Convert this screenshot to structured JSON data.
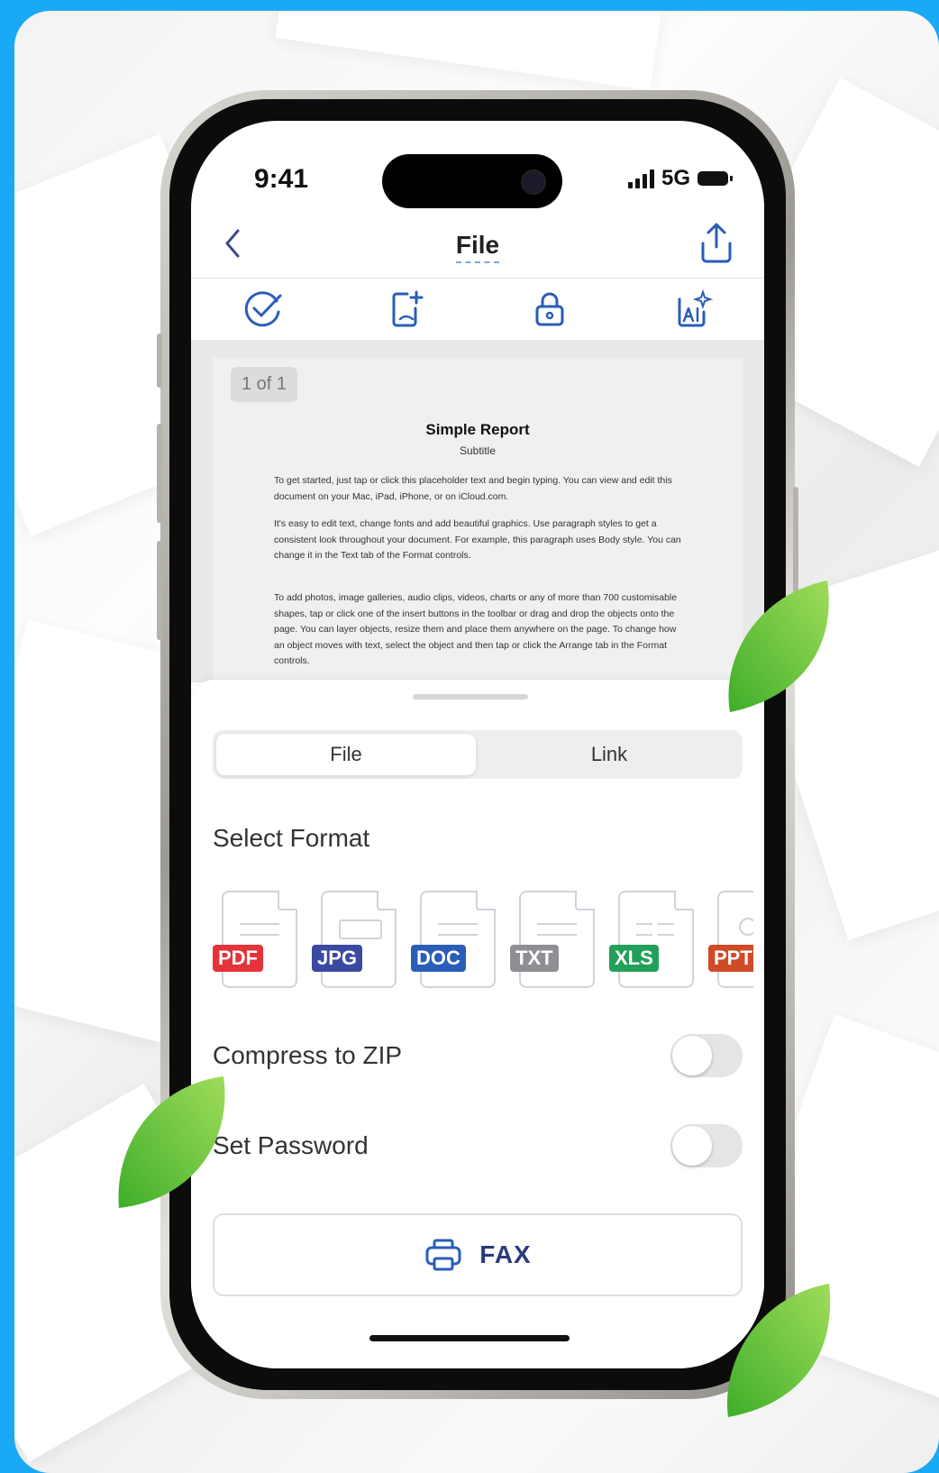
{
  "status": {
    "time": "9:41",
    "network": "5G"
  },
  "nav": {
    "title": "File"
  },
  "document": {
    "page_indicator": "1 of 1",
    "title": "Simple Report",
    "subtitle": "Subtitle",
    "paragraphs": [
      "To get started, just tap or click this placeholder text and begin typing. You can view and edit this document on your Mac, iPad, iPhone, or on iCloud.com.",
      "It's easy to edit text, change fonts and add beautiful graphics. Use paragraph styles to get a consistent look throughout your document. For example, this paragraph uses Body style. You can change it in the Text tab of the Format controls.",
      "To add photos, image galleries, audio clips, videos, charts or any of more than 700 customisable shapes, tap or click one of the insert buttons in the toolbar or drag and drop the objects onto the page. You can layer objects, resize them and place them anywhere on the page. To change how an object moves with text, select the object and then tap or click the Arrange tab in the Format controls."
    ]
  },
  "sheet": {
    "tabs": [
      {
        "label": "File",
        "active": true
      },
      {
        "label": "Link",
        "active": false
      }
    ],
    "select_format_label": "Select Format",
    "formats": [
      {
        "label": "PDF",
        "color": "#e5333a"
      },
      {
        "label": "JPG",
        "color": "#3b4aa0"
      },
      {
        "label": "DOC",
        "color": "#2a5db8"
      },
      {
        "label": "TXT",
        "color": "#8e8e93"
      },
      {
        "label": "XLS",
        "color": "#22a05a"
      },
      {
        "label": "PPT",
        "color": "#d04a28"
      }
    ],
    "compress_label": "Compress to ZIP",
    "compress_on": false,
    "password_label": "Set Password",
    "password_on": false,
    "fax_label": "FAX"
  },
  "icons": [
    "back-chevron-icon",
    "share-icon",
    "check-circle-icon",
    "add-page-icon",
    "lock-icon",
    "ai-sparkle-icon",
    "printer-icon"
  ]
}
